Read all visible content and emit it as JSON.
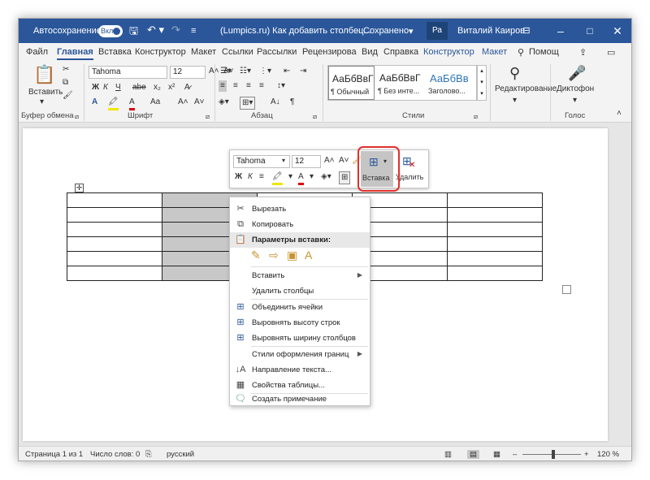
{
  "title_bar": {
    "autosave_label": "Автосохранение",
    "autosave_state": "Вкл.",
    "doc_title": "(Lumpics.ru) Как добавить столбец...",
    "save_status": "Сохранено",
    "user_initials": "Ра",
    "user_name": "Виталий Каиров",
    "colors": {
      "title_bar": "#2b579a"
    }
  },
  "ribbon_tabs": [
    {
      "label": "Файл"
    },
    {
      "label": "Главная"
    },
    {
      "label": "Вставка"
    },
    {
      "label": "Конструктор"
    },
    {
      "label": "Макет"
    },
    {
      "label": "Ссылки"
    },
    {
      "label": "Рассылки"
    },
    {
      "label": "Рецензирова"
    },
    {
      "label": "Вид"
    },
    {
      "label": "Справка"
    },
    {
      "label": "Конструктор"
    },
    {
      "label": "Макет"
    },
    {
      "label": "Помощ"
    }
  ],
  "ribbon": {
    "clipboard": {
      "paste_label": "Вставить",
      "group_label": "Буфер обмена"
    },
    "font": {
      "name": "Tahoma",
      "size": "12",
      "group_label": "Шрифт",
      "bold": "Ж",
      "italic": "К",
      "underline": "Ч",
      "strike": "abe",
      "sub": "x₂",
      "sup": "x²",
      "case": "Aa",
      "grow": "A˄",
      "shrink": "A˅"
    },
    "paragraph": {
      "group_label": "Абзац"
    },
    "styles": {
      "group_label": "Стили",
      "items": [
        {
          "sample": "АаБбВвГ",
          "name": "¶ Обычный"
        },
        {
          "sample": "АаБбВвГ",
          "name": "¶ Без инте..."
        },
        {
          "sample": "АаБбВв",
          "name": "Заголово..."
        }
      ]
    },
    "editing": {
      "label": "Редактирование"
    },
    "voice": {
      "label": "Диктофон",
      "group_label": "Голос"
    }
  },
  "mini_toolbar": {
    "font": "Tahoma",
    "size": "12",
    "bold": "Ж",
    "italic": "К",
    "insert_label": "Вставка",
    "delete_label": "Удалить"
  },
  "context_menu": {
    "items": [
      {
        "label": "Вырезать",
        "icon": "scissors-icon"
      },
      {
        "label": "Копировать",
        "icon": "copy-icon"
      },
      {
        "label": "Параметры вставки:",
        "icon": "paste-icon"
      },
      {
        "label": "Вставить"
      },
      {
        "label": "Удалить столбцы"
      },
      {
        "label": "Объединить ячейки",
        "icon": "merge-cells-icon"
      },
      {
        "label": "Выровнять высоту строк",
        "icon": "distribute-rows-icon"
      },
      {
        "label": "Выровнять ширину столбцов",
        "icon": "distribute-columns-icon"
      },
      {
        "label": "Стили оформления границ"
      },
      {
        "label": "Направление текста...",
        "icon": "text-direction-icon"
      },
      {
        "label": "Свойства таблицы...",
        "icon": "table-properties-icon"
      },
      {
        "label": "Создать примечание",
        "icon": "comment-icon"
      }
    ]
  },
  "document_table": {
    "rows": 6,
    "columns": 5,
    "selected_column": 2
  },
  "status_bar": {
    "page": "Страница 1 из 1",
    "words": "Число слов: 0",
    "language": "русский",
    "zoom": "120 %"
  }
}
